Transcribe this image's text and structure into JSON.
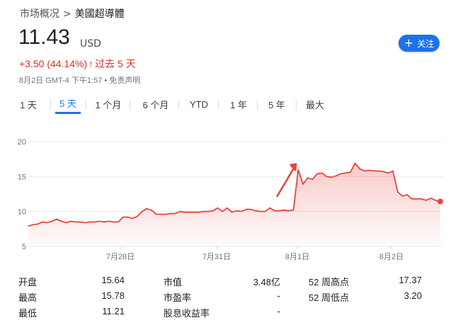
{
  "breadcrumb": {
    "parent": "市场概况",
    "separator": ">",
    "current": "美國超導體"
  },
  "quote": {
    "price": "11.43",
    "currency": "USD",
    "change": "+3.50 (44.14%)",
    "change_arrow": "↑",
    "period": "过去 5 天",
    "as_of": "8月2日 GMT-4 下午1:57 •",
    "disclaimer": "免责声明",
    "color": "#d93025"
  },
  "follow_button": {
    "icon": "plus-icon",
    "label": "关注",
    "color": "#1a73e8"
  },
  "tabs": [
    {
      "label": "1 天",
      "active": false
    },
    {
      "label": "5 天",
      "active": true
    },
    {
      "label": "1 个月",
      "active": false
    },
    {
      "label": "6 个月",
      "active": false
    },
    {
      "label": "YTD",
      "active": false
    },
    {
      "label": "1 年",
      "active": false
    },
    {
      "label": "5 年",
      "active": false
    },
    {
      "label": "最大",
      "active": false
    }
  ],
  "chart_data": {
    "type": "area",
    "x_ticks": [
      "7月28日",
      "7月31日",
      "8月1日",
      "8月2日"
    ],
    "y_ticks": [
      5,
      10,
      15,
      20
    ],
    "ylim": [
      5,
      20
    ],
    "grid": true,
    "line_color": "#e8453c",
    "series": [
      {
        "values": [
          7.9,
          8.1,
          8.2,
          8.5,
          8.4,
          8.6,
          8.9,
          8.6,
          8.4,
          8.6,
          8.5,
          8.5,
          8.4,
          8.5,
          8.5,
          8.6,
          8.5,
          8.6,
          8.5,
          8.5,
          9.2,
          9.2,
          9.0,
          9.3,
          10.0,
          10.4,
          10.2,
          9.6,
          9.6,
          9.6,
          9.7,
          9.7,
          10.0,
          9.9,
          9.9,
          9.9,
          9.9,
          10.0,
          10.0,
          10.1,
          10.5,
          10.0,
          10.5,
          9.9,
          10.1,
          10.0,
          10.3,
          10.3,
          10.1,
          10.0,
          10.0,
          10.5,
          10.1,
          10.1,
          10.2,
          10.1,
          10.2,
          16.0,
          13.9,
          14.8,
          14.6,
          15.4,
          15.5,
          15.0,
          14.9,
          15.1,
          15.4,
          15.5,
          15.6,
          16.9,
          16.1,
          15.8,
          15.9,
          15.8,
          15.8,
          15.7,
          15.5,
          15.8,
          12.8,
          12.2,
          12.4,
          11.8,
          11.8,
          11.8,
          11.6,
          11.9,
          11.6,
          11.43
        ]
      }
    ],
    "last_value": 11.43
  },
  "stats": {
    "col1": [
      {
        "label": "开盘",
        "value": "15.64"
      },
      {
        "label": "最高",
        "value": "15.78"
      },
      {
        "label": "最低",
        "value": "11.21"
      }
    ],
    "col2": [
      {
        "label": "市值",
        "value": "3.48亿"
      },
      {
        "label": "市盈率",
        "value": "-"
      },
      {
        "label": "股息收益率",
        "value": "-"
      }
    ],
    "col3": [
      {
        "label": "52 周高点",
        "value": "17.37"
      },
      {
        "label": "52 周低点",
        "value": "3.20"
      }
    ]
  },
  "annotation": {
    "icon": "red-arrow-annotation-icon",
    "color": "#e8453c"
  }
}
